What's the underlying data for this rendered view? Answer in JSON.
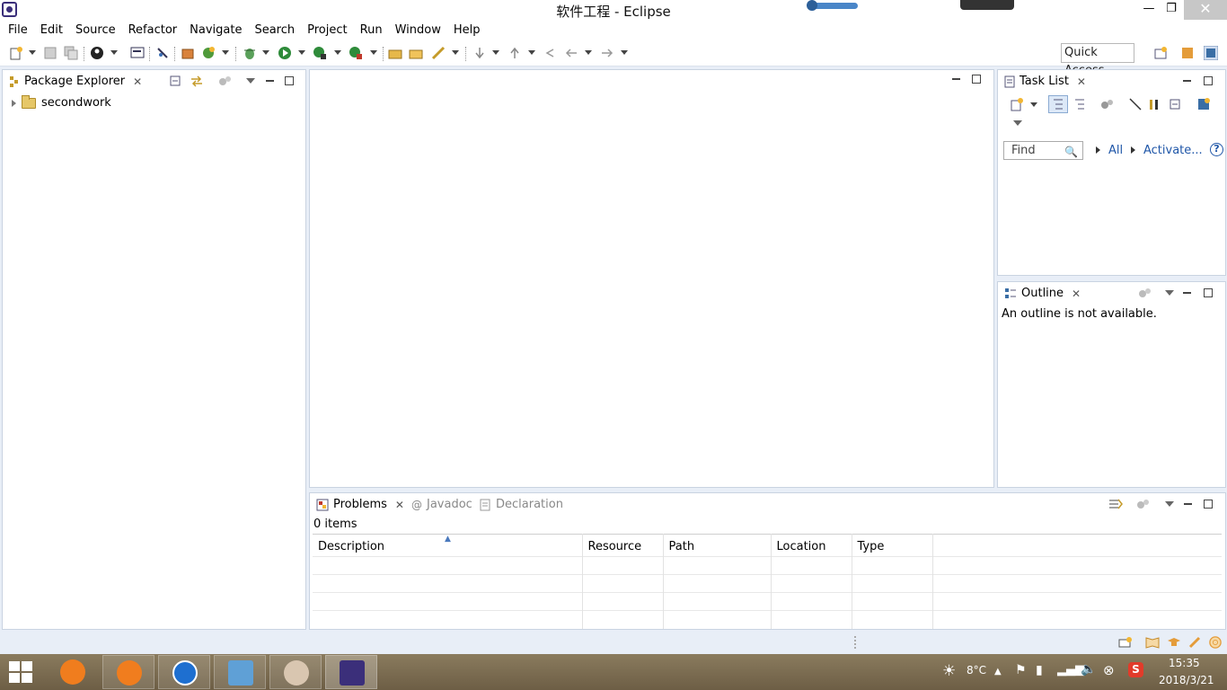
{
  "window": {
    "title": "软件工程 - Eclipse",
    "min_glyph": "—",
    "max_glyph": "❐",
    "close_glyph": "✕"
  },
  "menu": [
    "File",
    "Edit",
    "Source",
    "Refactor",
    "Navigate",
    "Search",
    "Project",
    "Run",
    "Window",
    "Help"
  ],
  "toolbar": {
    "quick_access": "Quick Access"
  },
  "package_explorer": {
    "tab_label": "Package Explorer",
    "tree": [
      {
        "label": "secondwork",
        "icon": "project-folder-icon"
      }
    ]
  },
  "task_list": {
    "tab_label": "Task List",
    "find_placeholder": "Find",
    "all_label": "All",
    "activate_label": "Activate...",
    "help_glyph": "?"
  },
  "outline": {
    "tab_label": "Outline",
    "message": "An outline is not available."
  },
  "problems": {
    "tabs": [
      {
        "label": "Problems",
        "active": true
      },
      {
        "label": "Javadoc",
        "active": false
      },
      {
        "label": "Declaration",
        "active": false
      }
    ],
    "item_count": "0 items",
    "columns": [
      "Description",
      "Resource",
      "Path",
      "Location",
      "Type"
    ]
  },
  "taskbar": {
    "weather": "8°C",
    "time": "15:35",
    "date": "2018/3/21"
  },
  "colors": {
    "link": "#1f56a8",
    "panel_border": "#c9d3e1",
    "workbench_bg": "#e8eef7"
  }
}
